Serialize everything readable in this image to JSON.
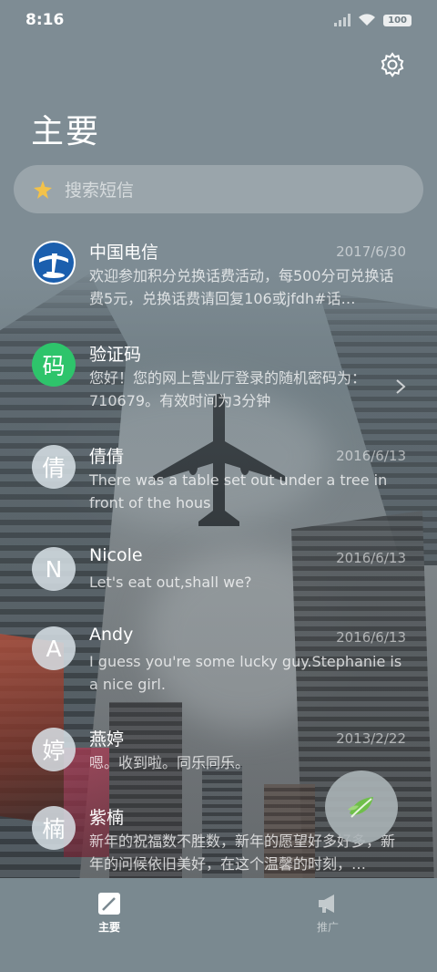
{
  "status": {
    "time": "8:16",
    "battery": "100"
  },
  "header": {
    "title": "主要"
  },
  "search": {
    "placeholder": "搜索短信"
  },
  "conversations": [
    {
      "name": "中国电信",
      "date": "2017/6/30",
      "snippet": "欢迎参加积分兑换话费活动，每500分可兑换话费5元，兑换话费请回复106或jfdh#话…",
      "avatar": "telecom-logo"
    },
    {
      "name": "验证码",
      "date": "",
      "snippet": "您好！您的网上营业厅登录的随机密码为：710679。有效时间为3分钟",
      "avatar_char": "码",
      "avatar_color": "#2ec46b"
    },
    {
      "name": "倩倩",
      "date": "2016/6/13",
      "snippet": "There was a table set out under a tree in front of the hous",
      "avatar_char": "倩"
    },
    {
      "name": "Nicole",
      "date": "2016/6/13",
      "snippet": "Let's eat out,shall we?",
      "avatar_char": "N"
    },
    {
      "name": "Andy",
      "date": "2016/6/13",
      "snippet": "I guess you're some lucky guy.Stephanie is a nice girl.",
      "avatar_char": "A"
    },
    {
      "name": "燕婷",
      "date": "2013/2/22",
      "snippet": "嗯。收到啦。同乐同乐。",
      "avatar_char": "婷"
    },
    {
      "name": "紫楠",
      "date": "",
      "snippet": "新年的祝福数不胜数，新年的愿望好多好多，新年的问候依旧美好，在这个温馨的时刻，…",
      "avatar_char": "楠"
    }
  ],
  "nav": [
    {
      "label": "主要",
      "icon": "edit-icon",
      "active": true
    },
    {
      "label": "推广",
      "icon": "megaphone-icon",
      "active": false
    }
  ],
  "fab": {
    "icon": "leaf-icon"
  }
}
